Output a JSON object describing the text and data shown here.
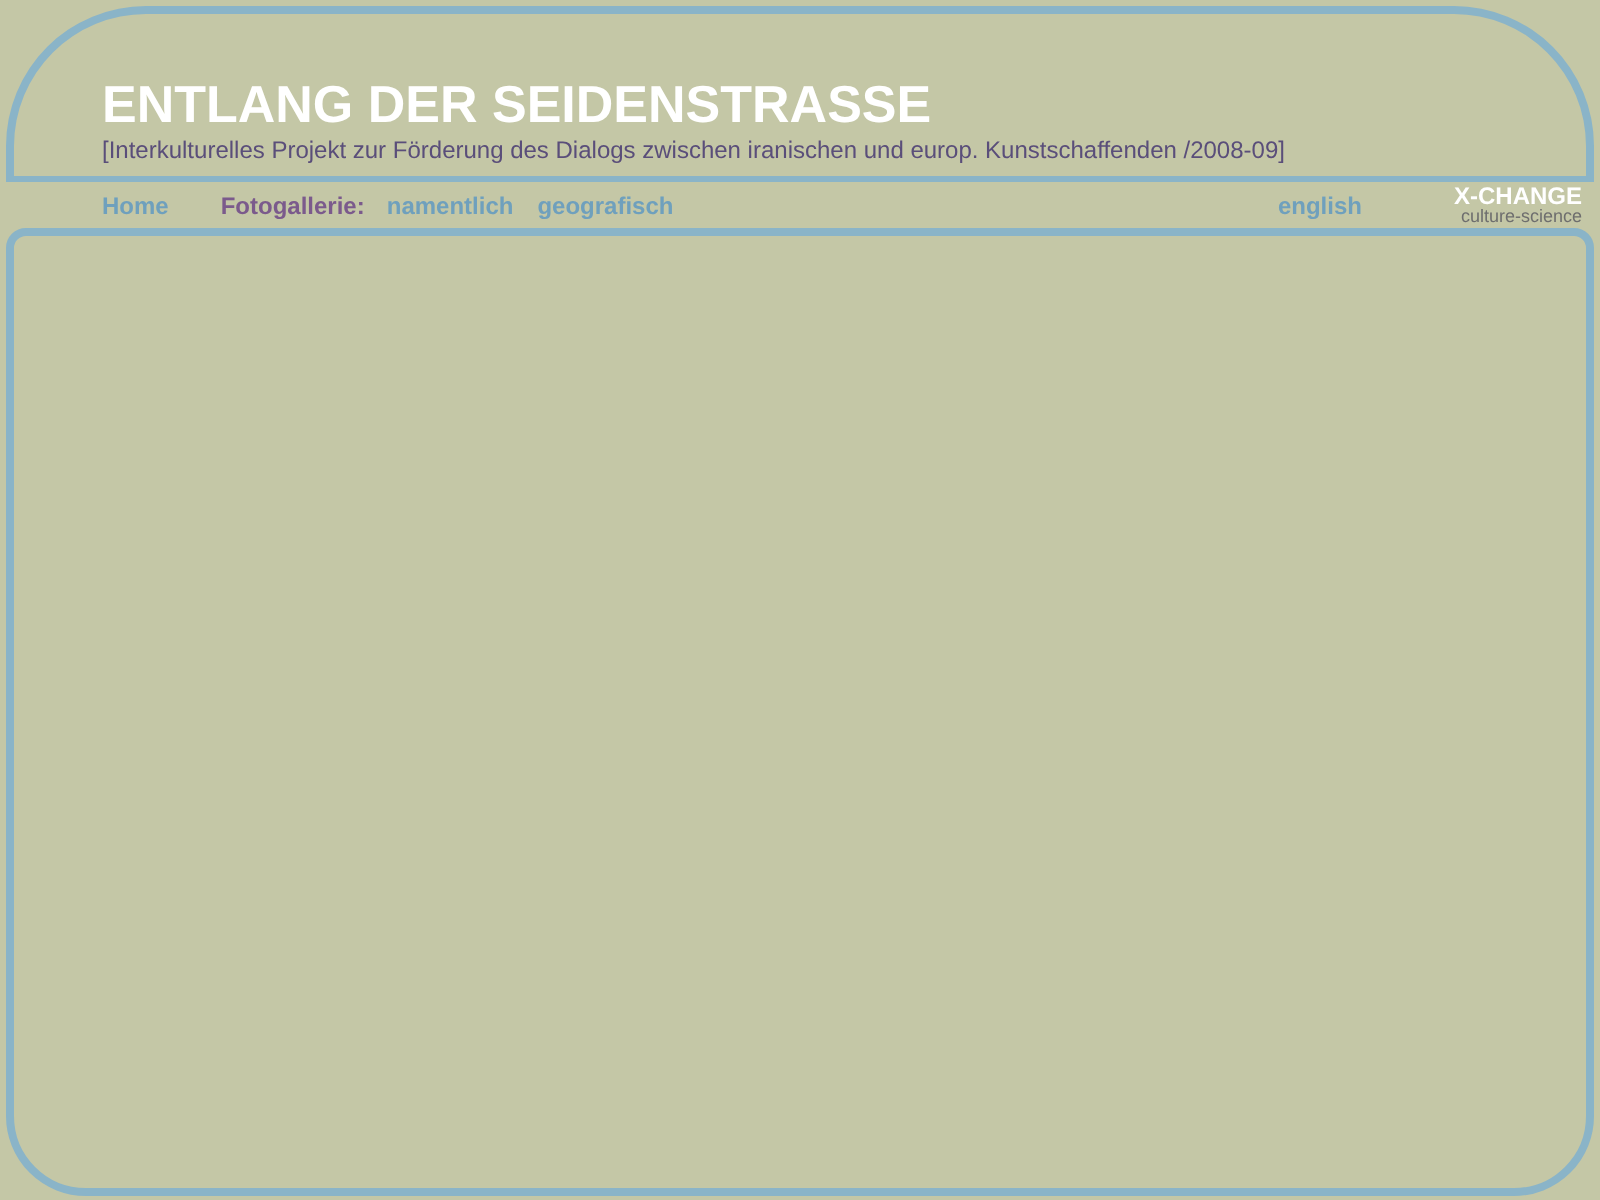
{
  "header": {
    "title": "ENTLANG DER SEIDENSTRASSE",
    "subtitle": "[Interkulturelles Projekt zur Förderung des Dialogs zwischen iranischen und europ. Kunstschaffenden /2008-09]"
  },
  "nav": [
    {
      "kind": "link",
      "label": "Home"
    },
    {
      "kind": "label",
      "label": "Fotogallerie:"
    },
    {
      "kind": "link",
      "label": "namentlich"
    },
    {
      "kind": "link",
      "label": "geografisch"
    }
  ],
  "language_link": "english",
  "logo": {
    "name": "X-CHANGE",
    "tagline": "culture-science"
  }
}
